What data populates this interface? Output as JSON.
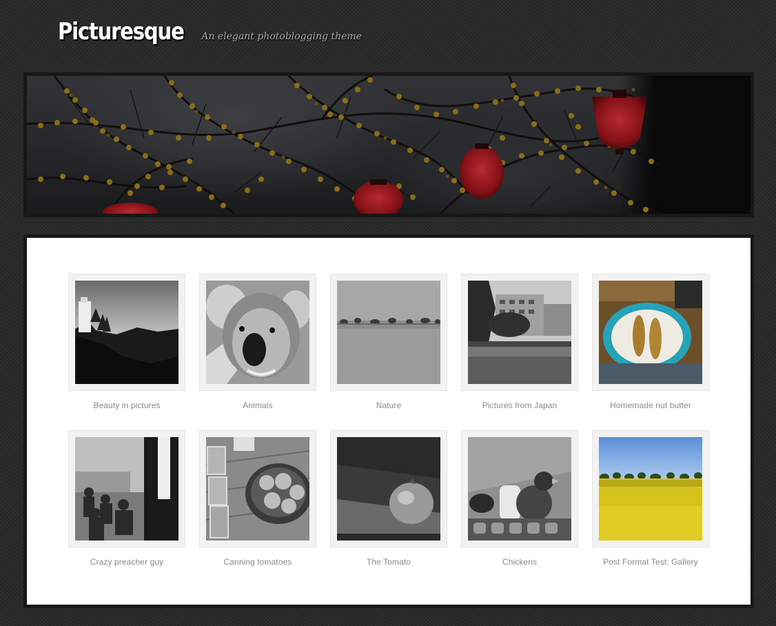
{
  "site": {
    "title": "Picturesque",
    "tagline": "An elegant photoblogging theme"
  },
  "gallery": {
    "items": [
      {
        "caption": "Beauty in pictures",
        "icon": "landscape-photo"
      },
      {
        "caption": "Animals",
        "icon": "koala-photo"
      },
      {
        "caption": "Nature",
        "icon": "field-photo"
      },
      {
        "caption": "Pictures from Japan",
        "icon": "building-photo"
      },
      {
        "caption": "Homemade nut butter",
        "icon": "plate-photo"
      },
      {
        "caption": "Crazy preacher guy",
        "icon": "crowd-photo"
      },
      {
        "caption": "Canning tomatoes",
        "icon": "jars-photo"
      },
      {
        "caption": "The Tomato",
        "icon": "tomato-photo"
      },
      {
        "caption": "Chickens",
        "icon": "chick-photo"
      },
      {
        "caption": "Post Format Test: Gallery",
        "icon": "canola-field-photo"
      }
    ]
  },
  "colors": {
    "background": "#2a2a2a",
    "panel": "#ffffff",
    "caption": "#888888",
    "lantern_red": "#c01c22",
    "blossom": "#a8851d"
  }
}
